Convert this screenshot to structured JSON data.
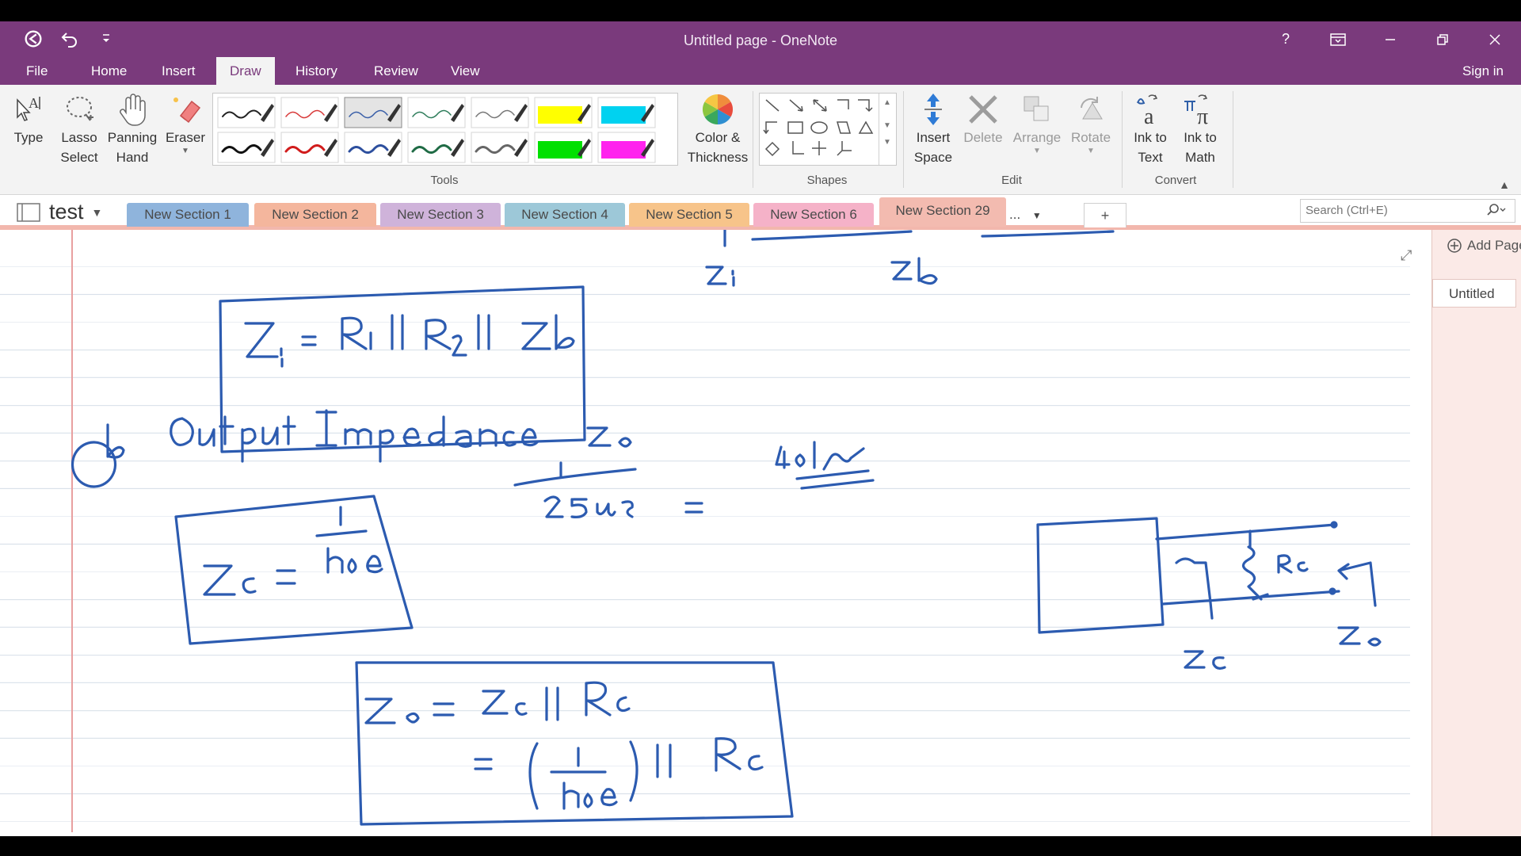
{
  "window": {
    "title": "Untitled page - OneNote",
    "help": "?",
    "accent": "#7a3a7c"
  },
  "menu": {
    "tabs": [
      "File",
      "Home",
      "Insert",
      "Draw",
      "History",
      "Review",
      "View"
    ],
    "active": "Draw",
    "sign_in": "Sign in"
  },
  "ribbon": {
    "type": "Type",
    "lasso": [
      "Lasso",
      "Select"
    ],
    "panning": [
      "Panning",
      "Hand"
    ],
    "eraser": "Eraser",
    "tools_group": "Tools",
    "color_thickness": [
      "Color &",
      "Thickness"
    ],
    "shapes_group": "Shapes",
    "insert_space": [
      "Insert",
      "Space"
    ],
    "delete": "Delete",
    "arrange": "Arrange",
    "rotate": "Rotate",
    "edit_group": "Edit",
    "ink_to_text": [
      "Ink to",
      "Text"
    ],
    "ink_to_math": [
      "Ink to",
      "Math"
    ],
    "convert_group": "Convert",
    "pens": [
      {
        "color": "#222222",
        "thick": 2,
        "highlighter": false
      },
      {
        "color": "#d83a3a",
        "thick": 1.5,
        "highlighter": false
      },
      {
        "color": "#3a5fa8",
        "thick": 1.5,
        "highlighter": false
      },
      {
        "color": "#2e7d5b",
        "thick": 1.5,
        "highlighter": false
      },
      {
        "color": "#777777",
        "thick": 1.5,
        "highlighter": false
      },
      {
        "color": "#ffff00",
        "thick": 0,
        "highlighter": true
      },
      {
        "color": "#00d2f0",
        "thick": 0,
        "highlighter": true
      },
      {
        "color": "#111111",
        "thick": 3,
        "highlighter": false
      },
      {
        "color": "#d11c1c",
        "thick": 3,
        "highlighter": false
      },
      {
        "color": "#2d4f9e",
        "thick": 3,
        "highlighter": false
      },
      {
        "color": "#1f6b45",
        "thick": 3,
        "highlighter": false
      },
      {
        "color": "#666666",
        "thick": 3,
        "highlighter": false
      },
      {
        "color": "#00e000",
        "thick": 0,
        "highlighter": true
      },
      {
        "color": "#ff22ee",
        "thick": 0,
        "highlighter": true
      }
    ],
    "selected_pen": 2
  },
  "notebook": {
    "name": "test",
    "sections": [
      {
        "label": "New Section 1",
        "color": "#8fb4dc"
      },
      {
        "label": "New Section 2",
        "color": "#f4b69d"
      },
      {
        "label": "New Section 3",
        "color": "#cfb3da"
      },
      {
        "label": "New Section 4",
        "color": "#9dc8d8"
      },
      {
        "label": "New Section 5",
        "color": "#f7c48a"
      },
      {
        "label": "New Section 6",
        "color": "#f5b2c8"
      },
      {
        "label": "New Section 29",
        "color": "#f3bbb0"
      }
    ],
    "active_section": "New Section 29",
    "more": "...",
    "add_section": "+"
  },
  "search": {
    "placeholder": "Search (Ctrl+E)"
  },
  "pages": {
    "add_page": "Add Page",
    "items": [
      "Untitled"
    ]
  },
  "ink": {
    "color": "#2c5bb0",
    "top_labels": [
      "Zi",
      "Zb"
    ],
    "eq_input": "Zi = R1 || R2 || Zb",
    "heading": "(b) Output Impedance",
    "z_o": "Zo",
    "fraction": "1 / 25 uS",
    "result": "40 kΩ",
    "eq_zc": "Zc = 1 / hoe",
    "eq_zo_line1": "Zo = Zc || Rc",
    "eq_zo_line2": "= (1 / hoe) || Rc",
    "circuit_labels": [
      "Rc",
      "Zo",
      "Zc"
    ]
  }
}
